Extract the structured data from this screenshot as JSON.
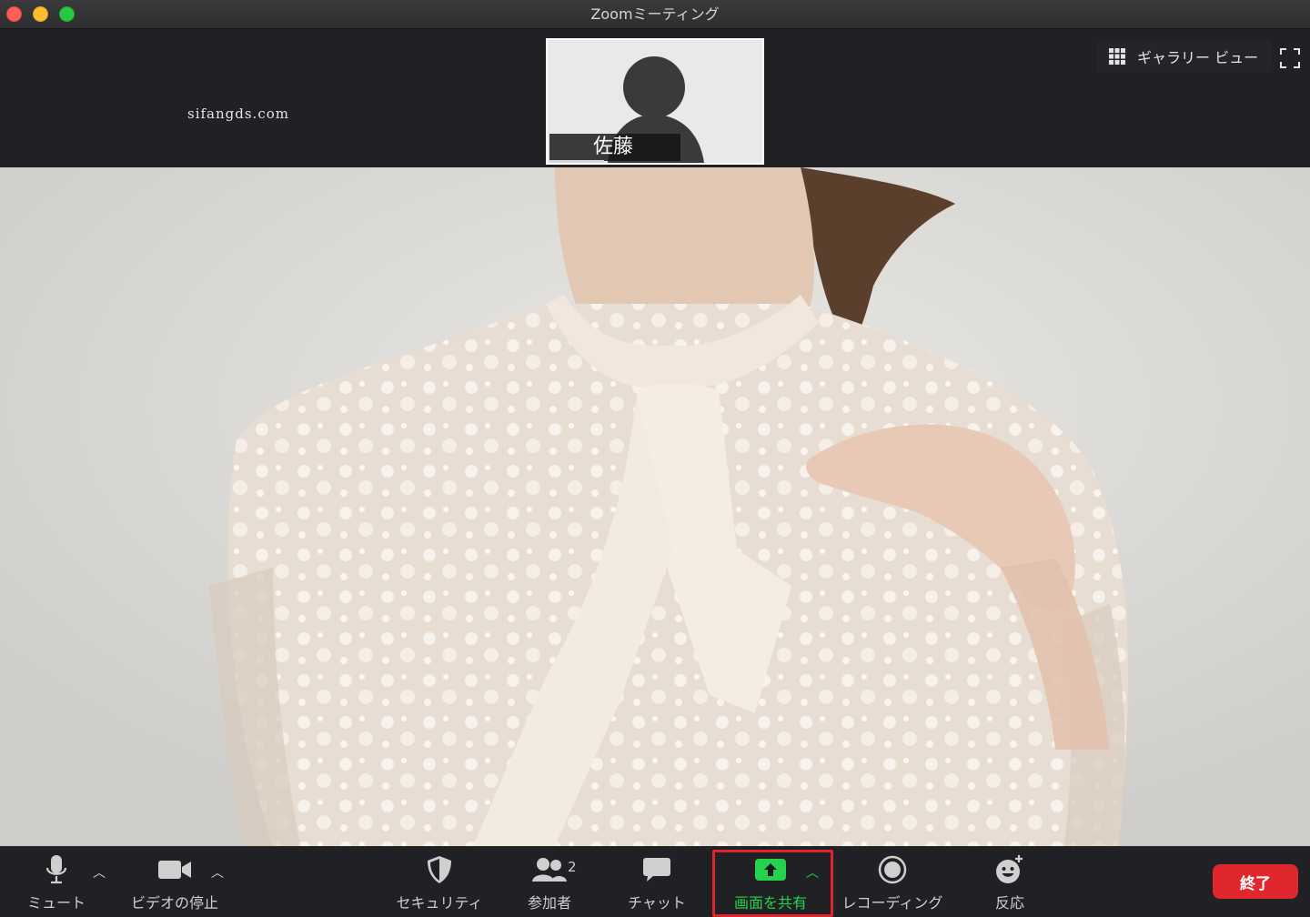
{
  "window": {
    "title": "Zoomミーティング"
  },
  "watermark": "sifangds.com",
  "thumbnail": {
    "participant_name": "佐藤"
  },
  "view": {
    "gallery_label": "ギャラリー ビュー"
  },
  "toolbar": {
    "mute_label": "ミュート",
    "video_label": "ビデオの停止",
    "security_label": "セキュリティ",
    "participants_label": "参加者",
    "participants_count": "2",
    "chat_label": "チャット",
    "share_label": "画面を共有",
    "recording_label": "レコーディング",
    "reactions_label": "反応",
    "end_label": "終了"
  },
  "colors": {
    "accent_green": "#26d24d",
    "highlight_red": "#e0232d",
    "end_red": "#e0272e"
  }
}
